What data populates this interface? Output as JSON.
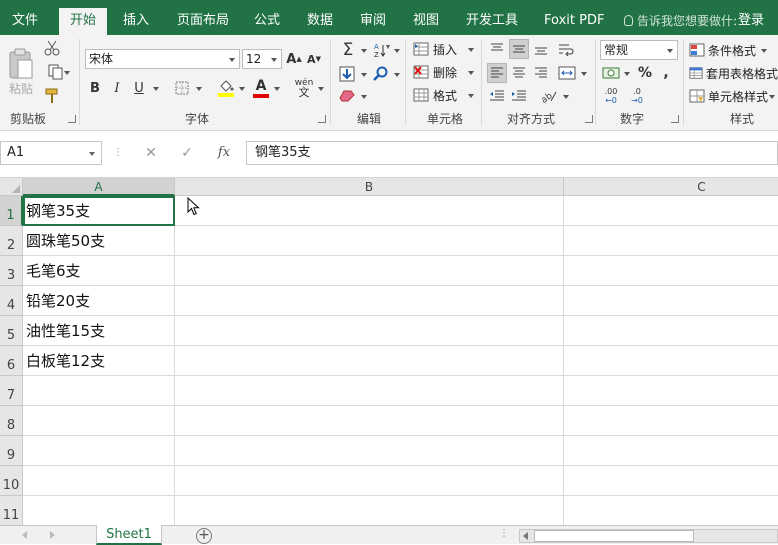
{
  "ribbon_tabs": [
    {
      "label": "文件",
      "active": false
    },
    {
      "label": "开始",
      "active": true
    },
    {
      "label": "插入",
      "active": false
    },
    {
      "label": "页面布局",
      "active": false
    },
    {
      "label": "公式",
      "active": false
    },
    {
      "label": "数据",
      "active": false
    },
    {
      "label": "审阅",
      "active": false
    },
    {
      "label": "视图",
      "active": false
    },
    {
      "label": "开发工具",
      "active": false
    },
    {
      "label": "Foxit PDF",
      "active": false
    }
  ],
  "tell_me": "告诉我您想要做什么",
  "login": "登录",
  "clipboard": {
    "paste": "粘贴",
    "group": "剪贴板"
  },
  "font": {
    "name": "宋体",
    "size": "12",
    "bold": "B",
    "italic": "I",
    "underline": "U",
    "group": "字体",
    "phonetic": "wén"
  },
  "editing": {
    "group": "编辑"
  },
  "cells": {
    "insert": "插入",
    "delete": "删除",
    "format": "格式",
    "group": "单元格"
  },
  "alignment": {
    "group": "对齐方式"
  },
  "number": {
    "format": "常规",
    "percent": "%",
    "comma": ",",
    "dec_inc": ".00",
    "dec_dec": ".0",
    "group": "数字"
  },
  "styles": {
    "conditional": "条件格式",
    "table": "套用表格格式",
    "cell_styles": "单元格样式",
    "group": "样式"
  },
  "formula_bar": {
    "name_box": "A1",
    "fx": "fx",
    "value": "钢笔35支"
  },
  "columns": [
    "A",
    "B",
    "C"
  ],
  "rows": [
    "1",
    "2",
    "3",
    "4",
    "5",
    "6",
    "7",
    "8",
    "9",
    "10",
    "11"
  ],
  "cell_values": [
    "钢笔35支",
    "圆珠笔50支",
    "毛笔6支",
    "铅笔20支",
    "油性笔15支",
    "白板笔12支",
    "",
    "",
    "",
    "",
    ""
  ],
  "selected_cell": "A1",
  "sheet_tabs": [
    {
      "label": "Sheet1",
      "active": true
    }
  ],
  "colors": {
    "accent": "#217346",
    "ribbon_bg": "#f3f3f3",
    "header_bg": "#e6e6e6",
    "gridline": "#dadada"
  },
  "icons": [
    "paste-icon",
    "cut-icon",
    "copy-icon",
    "format-painter-icon",
    "autosum-icon",
    "fill-icon",
    "clear-icon",
    "sort-filter-icon",
    "find-icon",
    "insert-cells-icon",
    "delete-cells-icon",
    "format-cells-icon",
    "border-icon",
    "fill-color-icon",
    "font-color-icon",
    "merge-center-icon",
    "wrap-text-icon",
    "currency-icon",
    "lightbulb-icon",
    "new-sheet-icon",
    "mouse-pointer-icon"
  ]
}
